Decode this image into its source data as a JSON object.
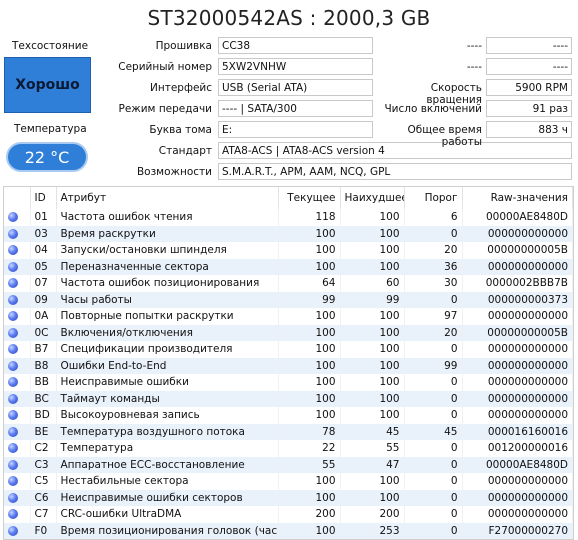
{
  "title": "ST32000542AS : 2000,3 GB",
  "status": {
    "label": "Техсостояние",
    "value": "Хорошо"
  },
  "temperature": {
    "label": "Температура",
    "value": "22 °C"
  },
  "info": {
    "firmware_label": "Прошивка",
    "firmware": "CC38",
    "serial_label": "Серийный номер",
    "serial": "5XW2VNHW",
    "interface_label": "Интерфейс",
    "interface": "USB (Serial ATA)",
    "transfer_label": "Режим передачи",
    "transfer": "---- | SATA/300",
    "volume_label": "Буква тома",
    "volume": "E:",
    "standard_label": "Стандарт",
    "standard": "ATA8-ACS | ATA8-ACS version 4",
    "features_label": "Возможности",
    "features": "S.M.A.R.T., APM, AAM, NCQ, GPL"
  },
  "right_info": {
    "blank1_label": "----",
    "blank1": "----",
    "blank2_label": "----",
    "blank2": "----",
    "rpm_label": "Скорость вращения",
    "rpm": "5900 RPM",
    "power_count_label": "Число включений",
    "power_count": "91 раз",
    "hours_label": "Общее время работы",
    "hours": "883 ч"
  },
  "table": {
    "headers": [
      "ID",
      "Атрибут",
      "Текущее",
      "Наихудшее",
      "Порог",
      "Raw-значения"
    ],
    "rows": [
      [
        "01",
        "Частота ошибок чтения",
        "118",
        "100",
        "6",
        "00000AE8480D"
      ],
      [
        "03",
        "Время раскрутки",
        "100",
        "100",
        "0",
        "000000000000"
      ],
      [
        "04",
        "Запуски/остановки шпинделя",
        "100",
        "100",
        "20",
        "00000000005B"
      ],
      [
        "05",
        "Переназначенные сектора",
        "100",
        "100",
        "36",
        "000000000000"
      ],
      [
        "07",
        "Частота ошибок позиционирования",
        "64",
        "60",
        "30",
        "0000002BBB7B"
      ],
      [
        "09",
        "Часы работы",
        "99",
        "99",
        "0",
        "000000000373"
      ],
      [
        "0A",
        "Повторные попытки раскрутки",
        "100",
        "100",
        "97",
        "000000000000"
      ],
      [
        "0C",
        "Включения/отключения",
        "100",
        "100",
        "20",
        "00000000005B"
      ],
      [
        "B7",
        "Спецификации производителя",
        "100",
        "100",
        "0",
        "000000000000"
      ],
      [
        "B8",
        "Ошибки End-to-End",
        "100",
        "100",
        "99",
        "000000000000"
      ],
      [
        "BB",
        "Неисправимые ошибки",
        "100",
        "100",
        "0",
        "000000000000"
      ],
      [
        "BC",
        "Таймаут команды",
        "100",
        "100",
        "0",
        "000000000000"
      ],
      [
        "BD",
        "Высокоуровневая запись",
        "100",
        "100",
        "0",
        "000000000000"
      ],
      [
        "BE",
        "Температура воздушного потока",
        "78",
        "45",
        "45",
        "000016160016"
      ],
      [
        "C2",
        "Температура",
        "22",
        "55",
        "0",
        "001200000016"
      ],
      [
        "C3",
        "Аппаратное ECC-восстановление",
        "55",
        "47",
        "0",
        "00000AE8480D"
      ],
      [
        "C5",
        "Нестабильные сектора",
        "100",
        "100",
        "0",
        "000000000000"
      ],
      [
        "C6",
        "Неисправимые ошибки секторов",
        "100",
        "100",
        "0",
        "000000000000"
      ],
      [
        "C7",
        "CRC-ошибки UltraDMA",
        "200",
        "200",
        "0",
        "000000000000"
      ],
      [
        "F0",
        "Время позиционирования головок (часы)",
        "100",
        "253",
        "0",
        "F27000000270"
      ]
    ]
  }
}
